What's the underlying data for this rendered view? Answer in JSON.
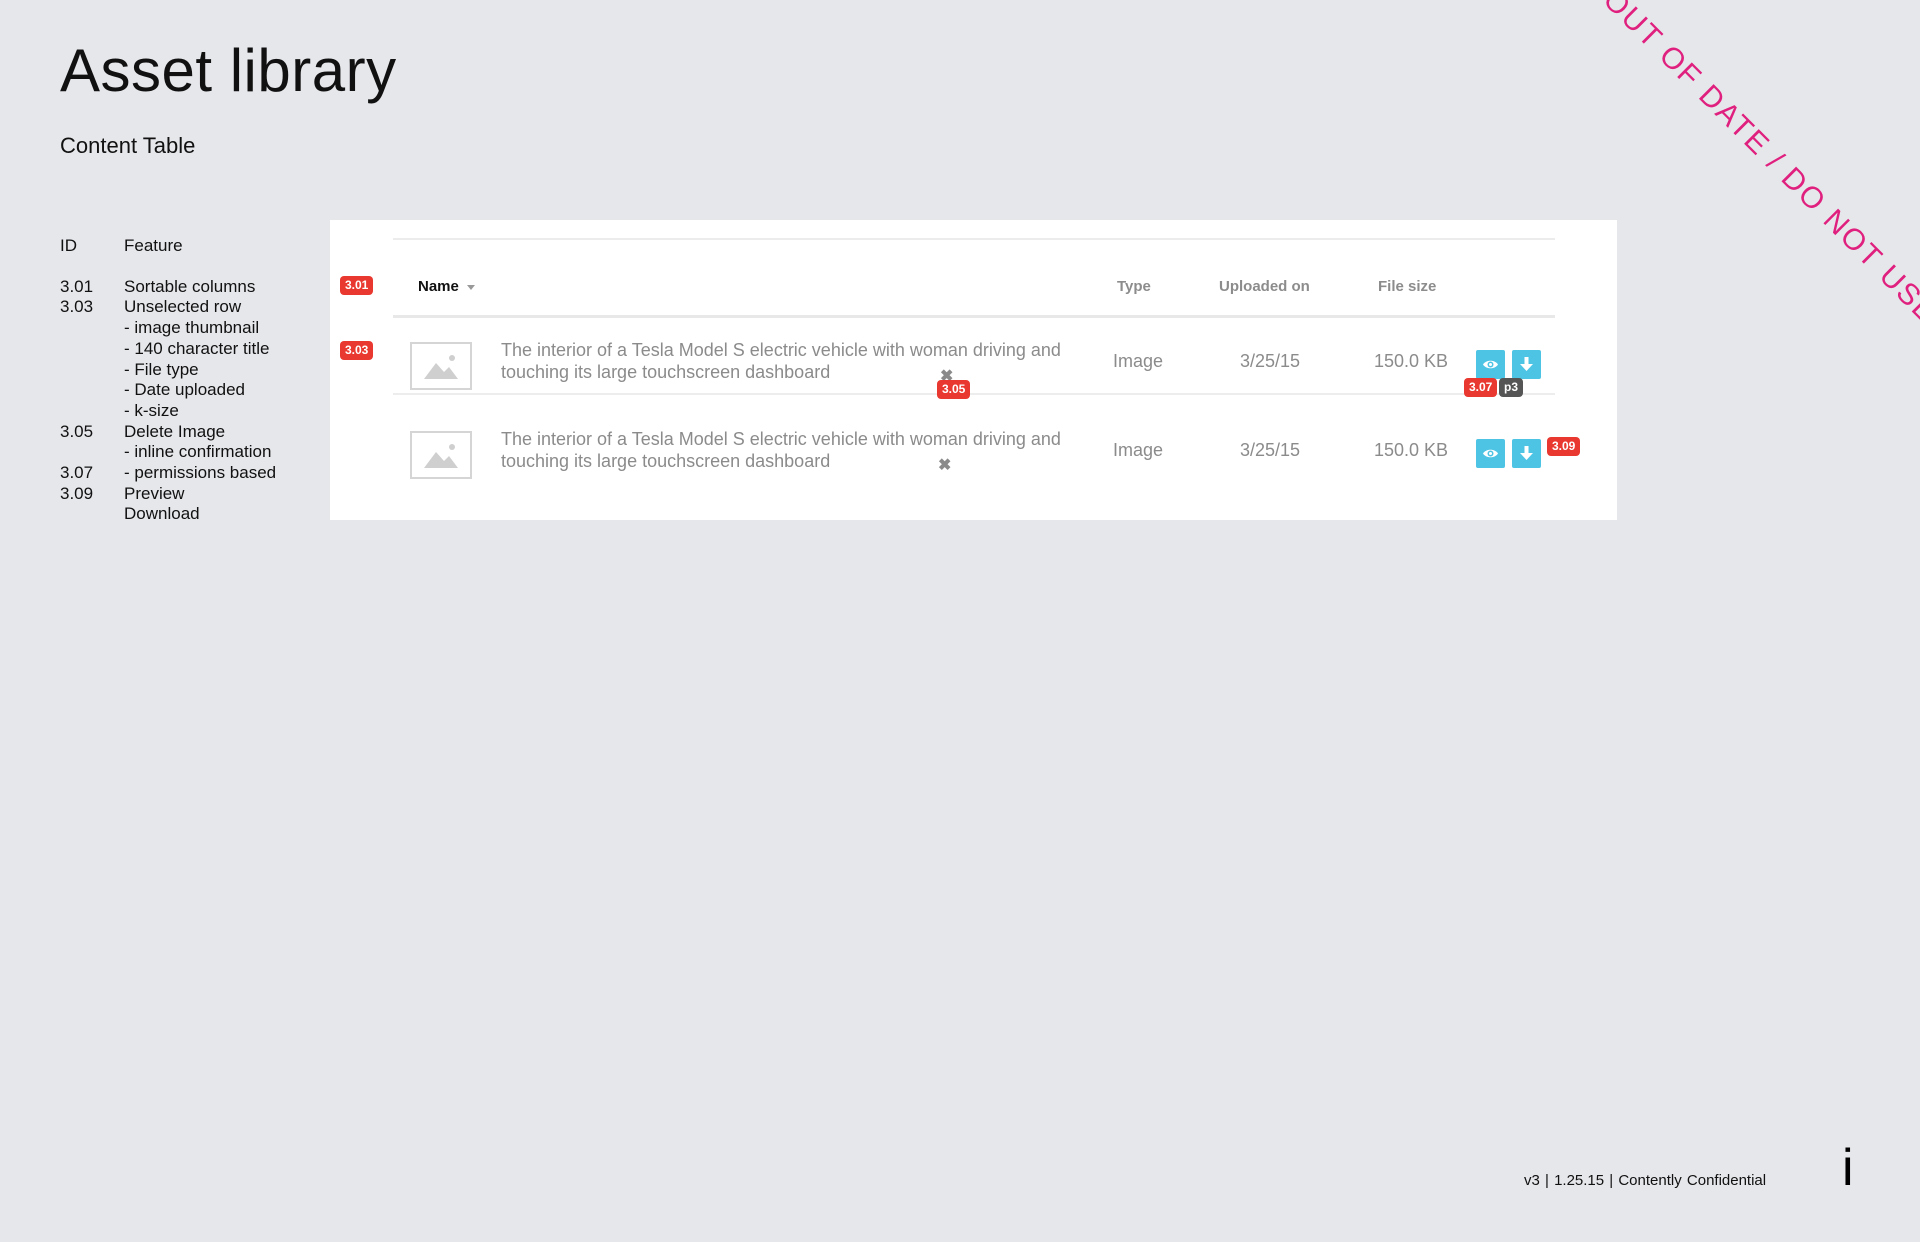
{
  "page": {
    "title": "Asset library",
    "subtitle": "Content Table",
    "stamp": "OUT OF DATE / DO NOT USE"
  },
  "legend": {
    "header": {
      "id": "ID",
      "feature": "Feature"
    },
    "rows": [
      {
        "id": "3.01",
        "text": "Sortable columns"
      },
      {
        "id": "3.03",
        "text": "Unselected row"
      },
      {
        "id": "",
        "text": "- image thumbnail"
      },
      {
        "id": "",
        "text": "- 140 character title"
      },
      {
        "id": "",
        "text": "- File type"
      },
      {
        "id": "",
        "text": "- Date uploaded"
      },
      {
        "id": "",
        "text": "- k-size"
      },
      {
        "id": "3.05",
        "text": "Delete Image"
      },
      {
        "id": "",
        "text": "- inline confirmation"
      },
      {
        "id": "3.07",
        "text": "- permissions based"
      },
      {
        "id": "3.09",
        "text": "Preview"
      },
      {
        "id": "",
        "text": "Download"
      }
    ]
  },
  "table": {
    "columns": {
      "name": "Name",
      "type": "Type",
      "uploaded": "Uploaded on",
      "size": "File size"
    },
    "rows": [
      {
        "title": "The interior of a Tesla Model S electric vehicle with woman driving and touching its large touchscreen dashboard",
        "type": "Image",
        "uploaded": "3/25/15",
        "size": "150.0 KB"
      },
      {
        "title": "The interior of a Tesla Model S electric vehicle with woman driving and touching its large touchscreen dashboard",
        "type": "Image",
        "uploaded": "3/25/15",
        "size": "150.0 KB"
      }
    ],
    "delete_glyph": "✖"
  },
  "badges": {
    "b301": "3.01",
    "b303": "3.03",
    "b305": "3.05",
    "b307": "3.07",
    "p3": "p3",
    "b309": "3.09"
  },
  "icons": {
    "thumbnail": "image-placeholder-icon",
    "preview": "eye-icon",
    "download": "arrow-down-icon",
    "delete": "close-icon"
  },
  "colors": {
    "accent": "#4ec4e4",
    "badge": "#e9382f",
    "stamp": "#e0207e"
  },
  "footer": {
    "version": "v3  | 1.25.15  | Contently Confidential",
    "info": "i"
  }
}
